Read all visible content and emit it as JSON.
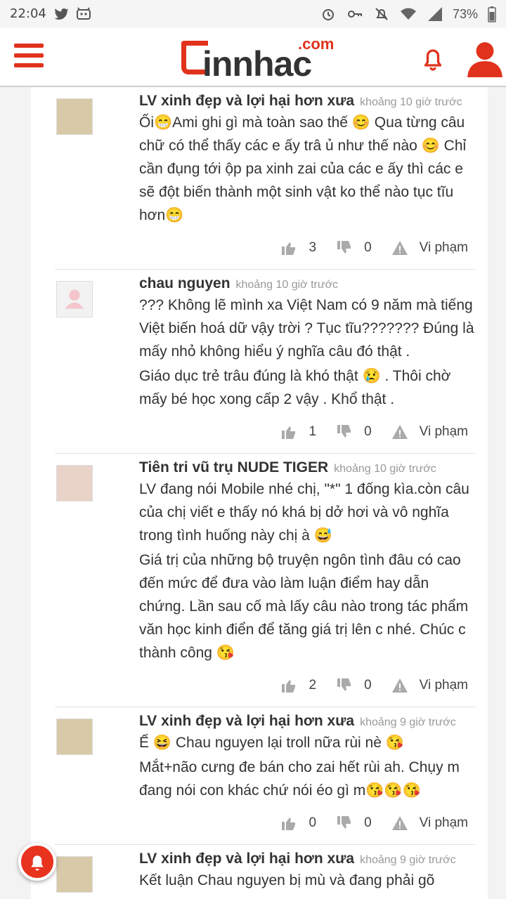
{
  "statusbar": {
    "time": "22:04",
    "battery": "73%",
    "icons": [
      "twitter-icon",
      "game-icon",
      "alarm-icon",
      "key-icon",
      "mute-icon",
      "wifi-icon",
      "signal-icon",
      "battery-icon"
    ]
  },
  "header": {
    "logo_com": ".com",
    "logo_word": "innhac",
    "accent": "#e0321c"
  },
  "comments": [
    {
      "author": "LV xinh đẹp và lợi hại hơn xưa",
      "time": "khoảng 10 giờ trước",
      "lines": [
        "Ối😁Ami ghi gì mà toàn sao thế 😊 Qua từng câu chữ có thể thấy các e ấy trâ ủ như thế nào 😊 Chỉ cần đụng tới ộp pa xinh zai của các e ấy thì các e sẽ đột biến thành một sinh vật ko thể nào tục tĩu hơn😁"
      ],
      "likes": "3",
      "dislikes": "0",
      "report": "Vi phạm"
    },
    {
      "author": "chau nguyen",
      "time": "khoảng 10 giờ trước",
      "lines": [
        "??? Không lẽ mình xa Việt Nam có 9 năm mà tiếng Việt biến hoá dữ vậy trời ? Tục tĩu??????? Đúng là mấy nhỏ không hiểu ý nghĩa câu đó thật .",
        "Giáo dục trẻ trâu đúng là khó thật 😢 . Thôi chờ mấy bé học xong cấp 2 vậy . Khổ thật ."
      ],
      "likes": "1",
      "dislikes": "0",
      "report": "Vi phạm"
    },
    {
      "author": "Tiên tri vũ trụ NUDE TIGER",
      "time": "khoảng 10 giờ trước",
      "lines": [
        "LV đang nói Mobile nhé chị, \"*\" 1 đống kìa.còn câu của chị viết e thấy nó khá bị dở hơi và vô nghĩa trong tình huống này chị à 😅",
        "Giá trị của những bộ truyện ngôn tình đâu có cao đến mức để đưa vào làm luận điểm hay dẫn chứng. Lần sau cố mà lấy câu nào trong tác phẩm văn học kinh điển để tăng giá trị lên c nhé. Chúc c thành công 😘"
      ],
      "likes": "2",
      "dislikes": "0",
      "report": "Vi phạm"
    },
    {
      "author": "LV xinh đẹp và lợi hại hơn xưa",
      "time": "khoảng 9 giờ trước",
      "lines": [
        "Ế 😆 Chau nguyen lại troll nữa rùi nè 😘",
        "Mắt+não cưng đe bán cho zai hết rùi ah. Chụy m đang nói con khác chứ nói éo gì m😘😘😘"
      ],
      "likes": "0",
      "dislikes": "0",
      "report": "Vi phạm"
    },
    {
      "author": "LV xinh đẹp và lợi hại hơn xưa",
      "time": "khoảng 9 giờ trước",
      "lines": [
        "Kết luận Chau nguyen bị mù và đang phải gõ"
      ],
      "likes": "",
      "dislikes": "",
      "report": ""
    }
  ]
}
